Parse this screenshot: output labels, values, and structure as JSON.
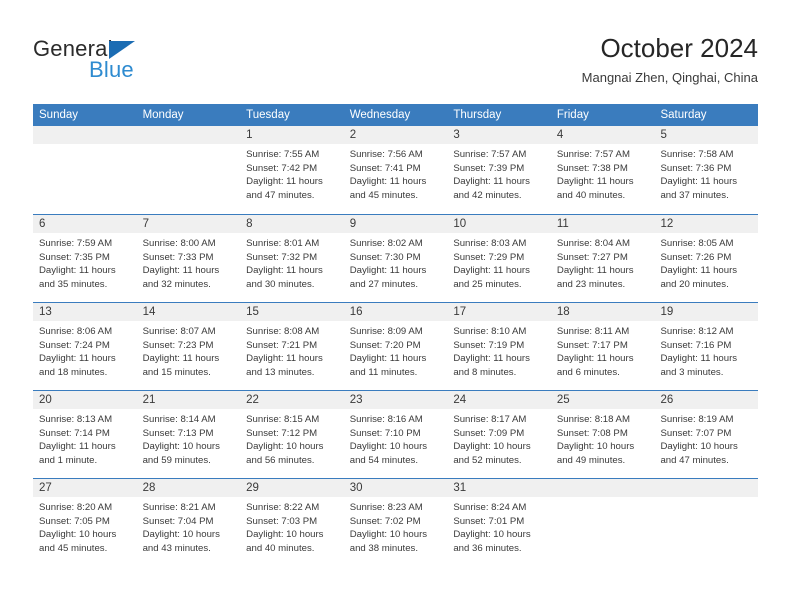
{
  "brand": {
    "name_part1": "General",
    "name_part2": "Blue",
    "triangle_color": "#1b6cb3",
    "blue_color": "#2e8bd0"
  },
  "header": {
    "title": "October 2024",
    "subtitle": "Mangnai Zhen, Qinghai, China"
  },
  "calendar": {
    "accent_color": "#3a7cbe",
    "day_band_color": "#f0f0f0",
    "weekdays": [
      "Sunday",
      "Monday",
      "Tuesday",
      "Wednesday",
      "Thursday",
      "Friday",
      "Saturday"
    ],
    "weeks": [
      [
        {
          "day": "",
          "empty": true
        },
        {
          "day": "",
          "empty": true
        },
        {
          "day": "1",
          "sunrise": "Sunrise: 7:55 AM",
          "sunset": "Sunset: 7:42 PM",
          "daylight": "Daylight: 11 hours and 47 minutes."
        },
        {
          "day": "2",
          "sunrise": "Sunrise: 7:56 AM",
          "sunset": "Sunset: 7:41 PM",
          "daylight": "Daylight: 11 hours and 45 minutes."
        },
        {
          "day": "3",
          "sunrise": "Sunrise: 7:57 AM",
          "sunset": "Sunset: 7:39 PM",
          "daylight": "Daylight: 11 hours and 42 minutes."
        },
        {
          "day": "4",
          "sunrise": "Sunrise: 7:57 AM",
          "sunset": "Sunset: 7:38 PM",
          "daylight": "Daylight: 11 hours and 40 minutes."
        },
        {
          "day": "5",
          "sunrise": "Sunrise: 7:58 AM",
          "sunset": "Sunset: 7:36 PM",
          "daylight": "Daylight: 11 hours and 37 minutes."
        }
      ],
      [
        {
          "day": "6",
          "sunrise": "Sunrise: 7:59 AM",
          "sunset": "Sunset: 7:35 PM",
          "daylight": "Daylight: 11 hours and 35 minutes."
        },
        {
          "day": "7",
          "sunrise": "Sunrise: 8:00 AM",
          "sunset": "Sunset: 7:33 PM",
          "daylight": "Daylight: 11 hours and 32 minutes."
        },
        {
          "day": "8",
          "sunrise": "Sunrise: 8:01 AM",
          "sunset": "Sunset: 7:32 PM",
          "daylight": "Daylight: 11 hours and 30 minutes."
        },
        {
          "day": "9",
          "sunrise": "Sunrise: 8:02 AM",
          "sunset": "Sunset: 7:30 PM",
          "daylight": "Daylight: 11 hours and 27 minutes."
        },
        {
          "day": "10",
          "sunrise": "Sunrise: 8:03 AM",
          "sunset": "Sunset: 7:29 PM",
          "daylight": "Daylight: 11 hours and 25 minutes."
        },
        {
          "day": "11",
          "sunrise": "Sunrise: 8:04 AM",
          "sunset": "Sunset: 7:27 PM",
          "daylight": "Daylight: 11 hours and 23 minutes."
        },
        {
          "day": "12",
          "sunrise": "Sunrise: 8:05 AM",
          "sunset": "Sunset: 7:26 PM",
          "daylight": "Daylight: 11 hours and 20 minutes."
        }
      ],
      [
        {
          "day": "13",
          "sunrise": "Sunrise: 8:06 AM",
          "sunset": "Sunset: 7:24 PM",
          "daylight": "Daylight: 11 hours and 18 minutes."
        },
        {
          "day": "14",
          "sunrise": "Sunrise: 8:07 AM",
          "sunset": "Sunset: 7:23 PM",
          "daylight": "Daylight: 11 hours and 15 minutes."
        },
        {
          "day": "15",
          "sunrise": "Sunrise: 8:08 AM",
          "sunset": "Sunset: 7:21 PM",
          "daylight": "Daylight: 11 hours and 13 minutes."
        },
        {
          "day": "16",
          "sunrise": "Sunrise: 8:09 AM",
          "sunset": "Sunset: 7:20 PM",
          "daylight": "Daylight: 11 hours and 11 minutes."
        },
        {
          "day": "17",
          "sunrise": "Sunrise: 8:10 AM",
          "sunset": "Sunset: 7:19 PM",
          "daylight": "Daylight: 11 hours and 8 minutes."
        },
        {
          "day": "18",
          "sunrise": "Sunrise: 8:11 AM",
          "sunset": "Sunset: 7:17 PM",
          "daylight": "Daylight: 11 hours and 6 minutes."
        },
        {
          "day": "19",
          "sunrise": "Sunrise: 8:12 AM",
          "sunset": "Sunset: 7:16 PM",
          "daylight": "Daylight: 11 hours and 3 minutes."
        }
      ],
      [
        {
          "day": "20",
          "sunrise": "Sunrise: 8:13 AM",
          "sunset": "Sunset: 7:14 PM",
          "daylight": "Daylight: 11 hours and 1 minute."
        },
        {
          "day": "21",
          "sunrise": "Sunrise: 8:14 AM",
          "sunset": "Sunset: 7:13 PM",
          "daylight": "Daylight: 10 hours and 59 minutes."
        },
        {
          "day": "22",
          "sunrise": "Sunrise: 8:15 AM",
          "sunset": "Sunset: 7:12 PM",
          "daylight": "Daylight: 10 hours and 56 minutes."
        },
        {
          "day": "23",
          "sunrise": "Sunrise: 8:16 AM",
          "sunset": "Sunset: 7:10 PM",
          "daylight": "Daylight: 10 hours and 54 minutes."
        },
        {
          "day": "24",
          "sunrise": "Sunrise: 8:17 AM",
          "sunset": "Sunset: 7:09 PM",
          "daylight": "Daylight: 10 hours and 52 minutes."
        },
        {
          "day": "25",
          "sunrise": "Sunrise: 8:18 AM",
          "sunset": "Sunset: 7:08 PM",
          "daylight": "Daylight: 10 hours and 49 minutes."
        },
        {
          "day": "26",
          "sunrise": "Sunrise: 8:19 AM",
          "sunset": "Sunset: 7:07 PM",
          "daylight": "Daylight: 10 hours and 47 minutes."
        }
      ],
      [
        {
          "day": "27",
          "sunrise": "Sunrise: 8:20 AM",
          "sunset": "Sunset: 7:05 PM",
          "daylight": "Daylight: 10 hours and 45 minutes."
        },
        {
          "day": "28",
          "sunrise": "Sunrise: 8:21 AM",
          "sunset": "Sunset: 7:04 PM",
          "daylight": "Daylight: 10 hours and 43 minutes."
        },
        {
          "day": "29",
          "sunrise": "Sunrise: 8:22 AM",
          "sunset": "Sunset: 7:03 PM",
          "daylight": "Daylight: 10 hours and 40 minutes."
        },
        {
          "day": "30",
          "sunrise": "Sunrise: 8:23 AM",
          "sunset": "Sunset: 7:02 PM",
          "daylight": "Daylight: 10 hours and 38 minutes."
        },
        {
          "day": "31",
          "sunrise": "Sunrise: 8:24 AM",
          "sunset": "Sunset: 7:01 PM",
          "daylight": "Daylight: 10 hours and 36 minutes."
        },
        {
          "day": "",
          "empty": true
        },
        {
          "day": "",
          "empty": true
        }
      ]
    ]
  }
}
